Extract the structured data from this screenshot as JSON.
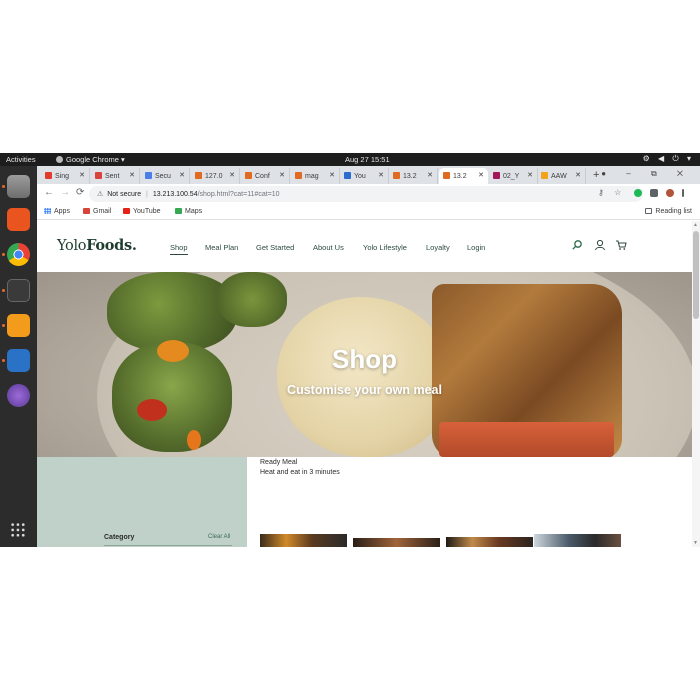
{
  "os": {
    "activities": "Activities",
    "active_app": "Google Chrome ▾",
    "clock": "Aug 27  15:51",
    "tray": "⚙ ◀ ⏻ ▾"
  },
  "tabs": [
    {
      "label": "Sing",
      "fav": "#e23b2e"
    },
    {
      "label": "Sent",
      "fav": "#d9443a"
    },
    {
      "label": "Secu",
      "fav": "#4a7ee8"
    },
    {
      "label": "127.0",
      "fav": "#e06a1f"
    },
    {
      "label": "Conf",
      "fav": "#e06a1f"
    },
    {
      "label": "mag",
      "fav": "#e06a1f"
    },
    {
      "label": "You",
      "fav": "#2b6cd1"
    },
    {
      "label": "13.2",
      "fav": "#e06a1f"
    },
    {
      "label": "13.2",
      "fav": "#e06a1f",
      "active": true
    },
    {
      "label": "02_Y",
      "fav": "#a4165a"
    },
    {
      "label": "AAW",
      "fav": "#f2a31b"
    }
  ],
  "tab_close": "✕",
  "new_tab": "+",
  "window_controls": "● – ⧉ ✕",
  "nav": {
    "back": "←",
    "forward": "→",
    "reload": "⟳"
  },
  "address": {
    "warn_icon": "⚠",
    "security": "Not secure",
    "sep": "|",
    "host": "13.213.100.54",
    "path": "/shop.html?cat=11#cat=10"
  },
  "omni_actions": "⚷ ☆",
  "bookmarks": {
    "apps": "Apps",
    "items": [
      {
        "label": "Gmail",
        "color": "#d9443a"
      },
      {
        "label": "YouTube",
        "color": "#e62117"
      },
      {
        "label": "Maps",
        "color": "#34a853"
      }
    ],
    "reading_list": "Reading list"
  },
  "site": {
    "logo_light": "Yolo",
    "logo_bold": "Foods.",
    "nav": [
      "Shop",
      "Meal Plan",
      "Get Started",
      "About Us",
      "Yolo Lifestyle",
      "Loyalty",
      "Login"
    ],
    "hero_title": "Shop",
    "hero_subtitle": "Customise your own meal",
    "category_title": "Category",
    "clear_all": "Clear All",
    "ready_meal": "Ready Meal",
    "ready_meal_desc": "Heat and eat in 3 minutes"
  },
  "colors": {
    "brand_green": "#1f3d2f",
    "sidebar_bg": "#bfd1c9",
    "accent_orange": "#e06a1f"
  }
}
